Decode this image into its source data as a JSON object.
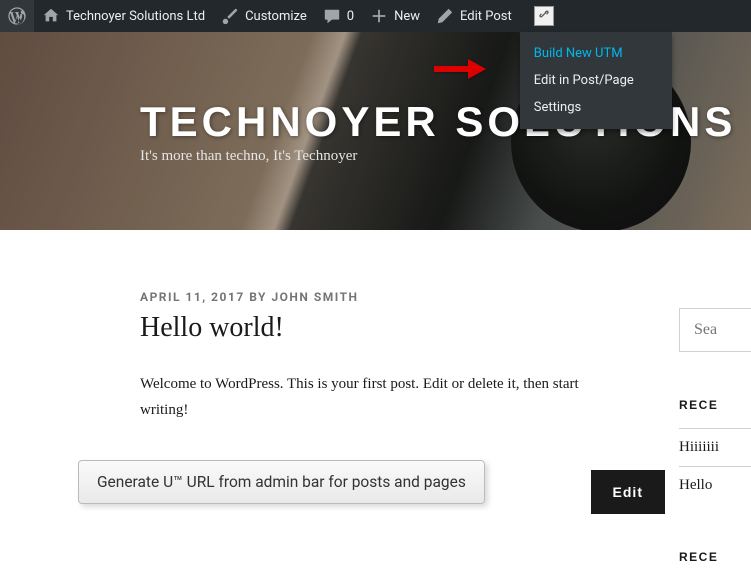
{
  "adminbar": {
    "site_name": "Technoyer Solutions Ltd",
    "customize": "Customize",
    "comments": "0",
    "new": "New",
    "edit_post": "Edit Post"
  },
  "dropdown": {
    "items": [
      {
        "label": "Build New UTM",
        "highlight": true
      },
      {
        "label": "Edit in Post/Page",
        "highlight": false
      },
      {
        "label": "Settings",
        "highlight": false
      }
    ]
  },
  "hero": {
    "title": "TECHNOYER SOLUTIONS LTD",
    "tagline": "It's more than techno, It's Technoyer"
  },
  "post": {
    "meta": "APRIL 11, 2017 BY JOHN SMITH",
    "title": "Hello world!",
    "body": "Welcome to WordPress. This is your first post. Edit or delete it, then start writing!",
    "edit_button": "Edit"
  },
  "sidebar": {
    "search_placeholder": "Search …",
    "search_partial": "Sea",
    "recent_h1": "RECE",
    "links": [
      "Hiiiiiii",
      "Hello"
    ],
    "recent_h2": "RECE"
  },
  "tooltip": "Generate U™ URL from admin bar for posts and pages"
}
